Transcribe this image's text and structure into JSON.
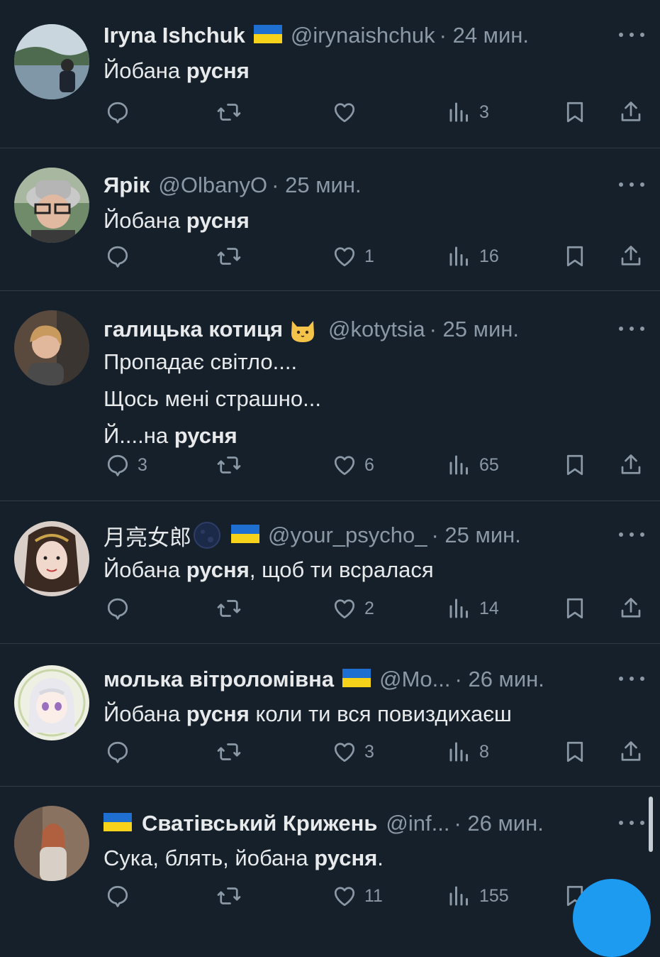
{
  "tweets": [
    {
      "name": "Iryna Ishchuk",
      "handle": "@irynaishchuk",
      "time": "· 24 мин.",
      "lines": [
        [
          "Йобана ",
          "русня",
          ""
        ]
      ],
      "stats": {
        "replies": "",
        "retweets": "",
        "likes": "",
        "views": "3"
      }
    },
    {
      "name": "Ярік",
      "handle": "@OlbanyO",
      "time": "· 25 мин.",
      "lines": [
        [
          "Йобана ",
          "русня",
          ""
        ]
      ],
      "stats": {
        "replies": "",
        "retweets": "",
        "likes": "1",
        "views": "16"
      }
    },
    {
      "name": "галицька котиця",
      "handle": "@kotytsia",
      "time": "· 25 мин.",
      "lines": [
        [
          "Пропадає світло....",
          "",
          ""
        ],
        [
          "Щось мені страшно...",
          "",
          ""
        ],
        [
          "Й....на ",
          "русня",
          ""
        ]
      ],
      "stats": {
        "replies": "3",
        "retweets": "",
        "likes": "6",
        "views": "65"
      }
    },
    {
      "name": "月亮女郎",
      "handle": "@your_psycho_",
      "time": "· 25 мин.",
      "lines": [
        [
          "Йобана ",
          "русня",
          ", щоб ти всралася"
        ]
      ],
      "stats": {
        "replies": "",
        "retweets": "",
        "likes": "2",
        "views": "14"
      }
    },
    {
      "name": "молька вітроломівна",
      "handle": "@Mo...",
      "time": "· 26 мин.",
      "lines": [
        [
          "Йобана ",
          "русня",
          " коли ти вся повиздихаєш"
        ]
      ],
      "stats": {
        "replies": "",
        "retweets": "",
        "likes": "3",
        "views": "8"
      }
    },
    {
      "name": "Сватівський Крижень",
      "handle": "@inf...",
      "time": "· 26 мин.",
      "lines": [
        [
          "Сука, блять, йобана ",
          "русня",
          "."
        ]
      ],
      "stats": {
        "replies": "",
        "retweets": "",
        "likes": "11",
        "views": "155"
      }
    }
  ],
  "icons": {
    "reply": "reply-icon",
    "retweet": "retweet-icon",
    "like": "heart-icon",
    "views": "views-icon",
    "bookmark": "bookmark-icon",
    "share": "share-icon",
    "more": "more-icon",
    "flag": "ukraine-flag-icon",
    "cat": "cat-emoji-icon",
    "moon": "moon-emoji-icon"
  },
  "colors": {
    "background": "#15202b",
    "text": "#e7e9ea",
    "secondary": "#8b98a5",
    "divider": "#2f3b47",
    "accent": "#1d9bf0"
  }
}
